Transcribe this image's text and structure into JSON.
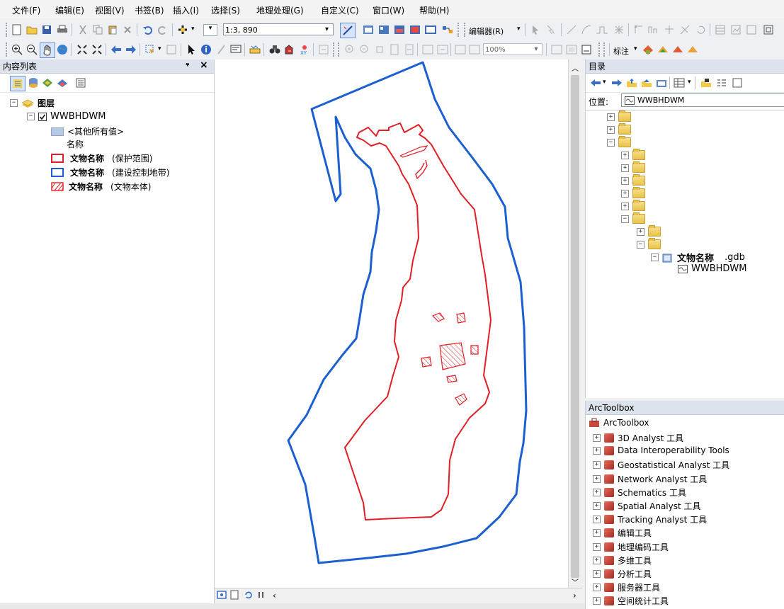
{
  "menu": [
    "文件(F)",
    "编辑(E)",
    "视图(V)",
    "书签(B)",
    "插入(I)",
    "选择(S)",
    "地理处理(G)",
    "自定义(C)",
    "窗口(W)",
    "帮助(H)"
  ],
  "toolbar": {
    "scale": "1:3, 890",
    "editor": "编辑器(R)",
    "zoom": "100%",
    "label": "标注"
  },
  "toc": {
    "title": "内容列表",
    "pin": "ᵠ",
    "close": "×",
    "group": "图层",
    "layer": "WWBHDWM",
    "other": "<其他所有值>",
    "field": "名称",
    "legend": [
      {
        "name": "文物名称",
        "note": "(保护范围)",
        "color": "#e21e26",
        "style": "outline"
      },
      {
        "name": "文物名称",
        "note": "(建设控制地带)",
        "color": "#1c5fd1",
        "style": "outline"
      },
      {
        "name": "文物名称",
        "note": "(文物本体)",
        "color": "#e21e26",
        "style": "hatch"
      }
    ]
  },
  "catalog": {
    "title": "目录",
    "location_label": "位置:",
    "location_value": "WWBHDWM",
    "gdb_name": "文物名称",
    "gdb_ext": ".gdb",
    "fc_name": "WWBHDWM"
  },
  "toolbox": {
    "title": "ArcToolbox",
    "root": "ArcToolbox",
    "items": [
      "3D Analyst 工具",
      "Data Interoperability Tools",
      "Geostatistical Analyst 工具",
      "Network Analyst 工具",
      "Schematics 工具",
      "Spatial Analyst 工具",
      "Tracking Analyst 工具",
      "编辑工具",
      "地理编码工具",
      "多维工具",
      "分析工具",
      "服务器工具",
      "空间统计工具"
    ]
  },
  "colors": {
    "protection": "#e21e26",
    "control": "#1c5fd1"
  }
}
